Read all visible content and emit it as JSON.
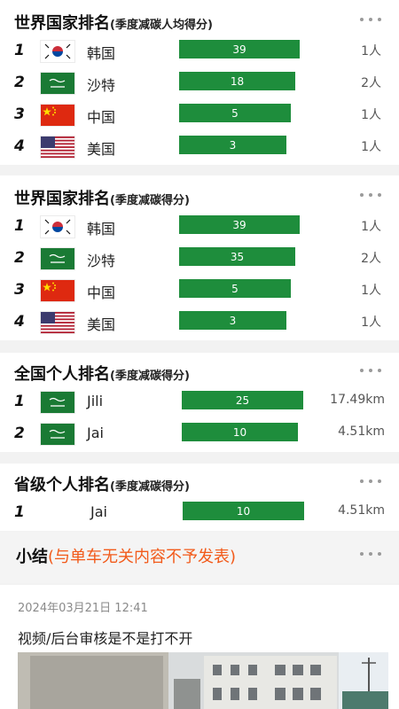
{
  "section1": {
    "title": "世界国家排名",
    "subtitle": "(季度减碳人均得分)",
    "rows": [
      {
        "rank": "1",
        "flag": "south-korea-flag",
        "name": "韩国",
        "score": "39",
        "people": "1人"
      },
      {
        "rank": "2",
        "flag": "saudi-arabia-flag",
        "name": "沙特",
        "score": "18",
        "people": "2人"
      },
      {
        "rank": "3",
        "flag": "china-flag",
        "name": "中国",
        "score": "5",
        "people": "1人"
      },
      {
        "rank": "4",
        "flag": "usa-flag",
        "name": "美国",
        "score": "3",
        "people": "1人"
      }
    ]
  },
  "section2": {
    "title": "世界国家排名",
    "subtitle": "(季度减碳得分)",
    "rows": [
      {
        "rank": "1",
        "flag": "south-korea-flag",
        "name": "韩国",
        "score": "39",
        "people": "1人"
      },
      {
        "rank": "2",
        "flag": "saudi-arabia-flag",
        "name": "沙特",
        "score": "35",
        "people": "2人"
      },
      {
        "rank": "3",
        "flag": "china-flag",
        "name": "中国",
        "score": "5",
        "people": "1人"
      },
      {
        "rank": "4",
        "flag": "usa-flag",
        "name": "美国",
        "score": "3",
        "people": "1人"
      }
    ]
  },
  "section3": {
    "title": "全国个人排名",
    "subtitle": "(季度减碳得分)",
    "rows": [
      {
        "rank": "1",
        "flag": "saudi-arabia-flag",
        "name": "Jili",
        "score": "25",
        "distance": "17.49km"
      },
      {
        "rank": "2",
        "flag": "saudi-arabia-flag",
        "name": "Jai",
        "score": "10",
        "distance": "4.51km"
      }
    ]
  },
  "section4": {
    "title": "省级个人排名",
    "subtitle": "(季度减碳得分)",
    "rows": [
      {
        "rank": "1",
        "name": "Jai",
        "score": "10",
        "distance": "4.51km"
      }
    ]
  },
  "summary": {
    "title": "小结",
    "note": "(与单车无关内容不予发表)"
  },
  "post": {
    "timestamp": "2024年03月21日 12:41",
    "text": "视频/后台审核是不是打不开"
  },
  "colors": {
    "bar": "#1e8d3c",
    "note": "#f25a1a"
  }
}
